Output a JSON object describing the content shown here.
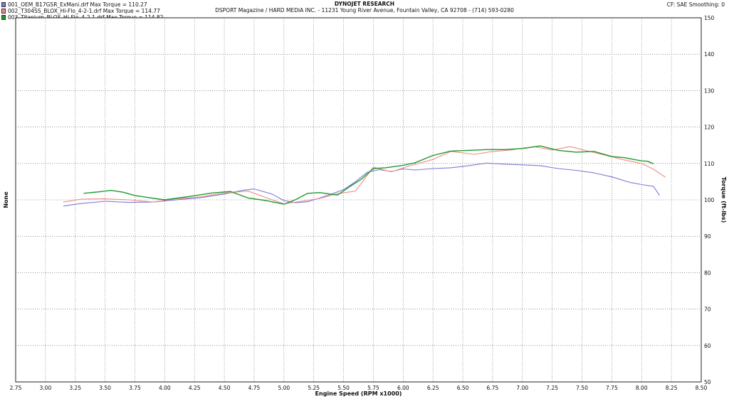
{
  "header": {
    "title": "DYNOJET RESEARCH",
    "address": "DSPORT Magazine / HARD MEDIA INC. - 11231 Young River Avenue, Fountain Valley, CA 92708 - (714) 593-0280",
    "settings": "CF: SAE  Smoothing: 0"
  },
  "chart_data": {
    "type": "line",
    "xlabel": "Engine Speed (RPM x1000)",
    "ylabel_left": "None",
    "ylabel_right": "Torque (ft-lbs)",
    "xlim": [
      2.75,
      8.5
    ],
    "ylim": [
      50,
      150
    ],
    "x_ticks": [
      "2.75",
      "3.00",
      "3.25",
      "3.50",
      "3.75",
      "4.00",
      "4.25",
      "4.50",
      "4.75",
      "5.00",
      "5.25",
      "5.50",
      "5.75",
      "6.00",
      "6.25",
      "6.50",
      "6.75",
      "7.00",
      "7.25",
      "7.50",
      "7.75",
      "8.00",
      "8.25",
      "8.50"
    ],
    "y_ticks": [
      "150",
      "140",
      "130",
      "120",
      "110",
      "100",
      "90",
      "80",
      "70",
      "60",
      "50"
    ],
    "grid": true,
    "legend_position": "top-left",
    "series": [
      {
        "name": "001_OEM_B17GSR_ExMani.drf Max Torque = 110.27",
        "color": "#7b7bd6",
        "x": [
          3.15,
          3.3,
          3.5,
          3.7,
          3.9,
          4.1,
          4.3,
          4.5,
          4.65,
          4.75,
          4.9,
          5.0,
          5.1,
          5.2,
          5.3,
          5.4,
          5.5,
          5.6,
          5.7,
          5.8,
          5.9,
          6.0,
          6.1,
          6.25,
          6.4,
          6.55,
          6.7,
          6.85,
          7.0,
          7.15,
          7.3,
          7.45,
          7.6,
          7.75,
          7.9,
          8.0,
          8.1,
          8.15
        ],
        "y": [
          98.3,
          99,
          99.6,
          99.3,
          99.4,
          100,
          100.6,
          101.6,
          102.6,
          103,
          101.6,
          99.8,
          99.2,
          99.5,
          100.5,
          101.6,
          102.8,
          105,
          107.6,
          108.3,
          107.8,
          108.5,
          108.2,
          108.6,
          108.8,
          109.4,
          110.1,
          109.8,
          109.6,
          109.4,
          108.6,
          108.1,
          107.4,
          106.3,
          104.8,
          104.2,
          103.7,
          101.2
        ]
      },
      {
        "name": "002_T304SS_BLOX_Hi-Flo_4-2-1.drf Max Torque = 114.77",
        "color": "#f08a8a",
        "x": [
          3.15,
          3.3,
          3.5,
          3.7,
          3.9,
          4.1,
          4.3,
          4.5,
          4.7,
          4.85,
          5.0,
          5.15,
          5.3,
          5.45,
          5.6,
          5.75,
          5.9,
          6.05,
          6.25,
          6.4,
          6.6,
          6.75,
          6.9,
          7.0,
          7.1,
          7.25,
          7.4,
          7.55,
          7.7,
          7.85,
          8.0,
          8.1,
          8.2
        ],
        "y": [
          99.4,
          100.2,
          100.3,
          100,
          99.4,
          100.3,
          100.8,
          101.9,
          102.4,
          100.6,
          98.9,
          99.6,
          100.4,
          101.7,
          102.4,
          109,
          107.7,
          109.3,
          111.1,
          113.3,
          112.5,
          113.3,
          113.7,
          114.2,
          114.6,
          113.7,
          114.6,
          113.4,
          112.2,
          111,
          110,
          108.4,
          106.2
        ]
      },
      {
        "name": "003_Titanium_BLOX_Hi-Flo_4-2-1.drf Max Torque = 114.82",
        "color": "#1f9a2e",
        "x": [
          3.32,
          3.45,
          3.55,
          3.65,
          3.75,
          3.85,
          4.0,
          4.2,
          4.4,
          4.55,
          4.7,
          4.85,
          5.0,
          5.1,
          5.2,
          5.3,
          5.45,
          5.55,
          5.65,
          5.75,
          5.85,
          6.0,
          6.1,
          6.25,
          6.4,
          6.55,
          6.7,
          6.85,
          7.0,
          7.15,
          7.3,
          7.45,
          7.6,
          7.75,
          7.85,
          8.0,
          8.05,
          8.1
        ],
        "y": [
          101.8,
          102.2,
          102.6,
          102.1,
          101.2,
          100.7,
          100,
          100.9,
          101.9,
          102.3,
          100.5,
          99.8,
          98.8,
          100.1,
          101.8,
          102,
          101.3,
          103.6,
          105.7,
          108.6,
          108.8,
          109.5,
          110.2,
          112.2,
          113.4,
          113.6,
          113.8,
          113.8,
          114.1,
          114.8,
          113.6,
          113.1,
          113.3,
          111.9,
          111.6,
          110.7,
          110.6,
          109.9
        ]
      }
    ]
  }
}
